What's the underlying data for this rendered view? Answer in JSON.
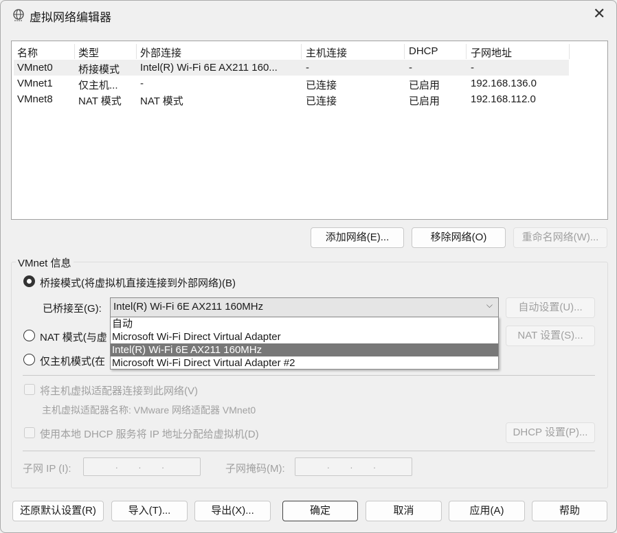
{
  "window": {
    "title": "虚拟网络编辑器",
    "close": "✕"
  },
  "table": {
    "headers": [
      "名称",
      "类型",
      "外部连接",
      "主机连接",
      "DHCP",
      "子网地址"
    ],
    "rows": [
      [
        "VMnet0",
        "桥接模式",
        "Intel(R) Wi-Fi 6E AX211 160...",
        "-",
        "-",
        "-"
      ],
      [
        "VMnet1",
        "仅主机...",
        "-",
        "已连接",
        "已启用",
        "192.168.136.0"
      ],
      [
        "VMnet8",
        "NAT 模式",
        "NAT 模式",
        "已连接",
        "已启用",
        "192.168.112.0"
      ]
    ]
  },
  "list_buttons": {
    "add": "添加网络(E)...",
    "remove": "移除网络(O)",
    "rename": "重命名网络(W)..."
  },
  "info": {
    "group_label": "VMnet 信息",
    "bridged_label": "桥接模式(将虚拟机直接连接到外部网络)(B)",
    "bridged_to_label": "已桥接至(G):",
    "bridged_to_value": "Intel(R) Wi-Fi 6E AX211 160MHz",
    "dropdown_options": [
      "自动",
      "Microsoft Wi-Fi Direct Virtual Adapter",
      "Intel(R) Wi-Fi 6E AX211 160MHz",
      "Microsoft Wi-Fi Direct Virtual Adapter #2"
    ],
    "auto_settings": "自动设置(U)...",
    "nat_label": "NAT 模式(与虚",
    "nat_settings": "NAT 设置(S)...",
    "hostonly_label": "仅主机模式(在",
    "connect_adapter": "将主机虚拟适配器连接到此网络(V)",
    "adapter_name": "主机虚拟适配器名称: VMware 网络适配器 VMnet0",
    "use_dhcp": "使用本地 DHCP 服务将 IP 地址分配给虚拟机(D)",
    "dhcp_settings": "DHCP 设置(P)...",
    "subnet_ip_label": "子网 IP (I):",
    "subnet_mask_label": "子网掩码(M):",
    "ip_dots": "...",
    "mask_dots": "..."
  },
  "footer": {
    "restore": "还原默认设置(R)",
    "import": "导入(T)...",
    "export": "导出(X)...",
    "ok": "确定",
    "cancel": "取消",
    "apply": "应用(A)",
    "help": "帮助"
  }
}
